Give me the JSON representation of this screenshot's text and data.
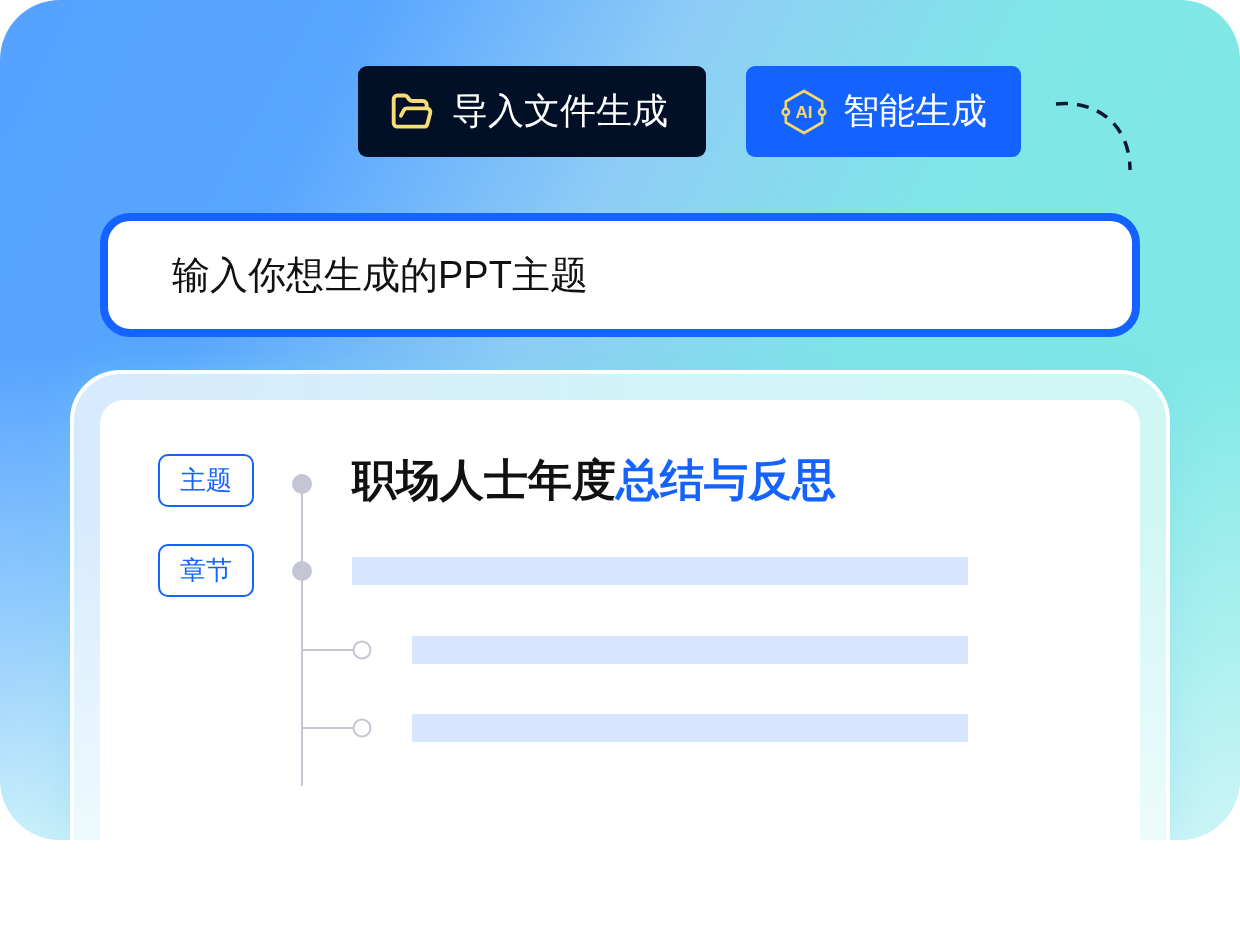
{
  "actions": [
    {
      "kind": "import",
      "label": "导入文件生成"
    },
    {
      "kind": "ai",
      "label": "智能生成",
      "icon_text": "AI"
    }
  ],
  "topic_input": {
    "placeholder": "输入你想生成的PPT主题"
  },
  "outline": {
    "nodes": [
      {
        "kind": "title",
        "tag": "主题",
        "segments": [
          {
            "text": "职场人士年度",
            "highlight": false
          },
          {
            "text": "总结与反思",
            "highlight": true
          }
        ]
      },
      {
        "kind": "skeleton",
        "tag": "章节",
        "children": [
          {
            "kind": "skeleton"
          },
          {
            "kind": "skeleton"
          }
        ]
      }
    ]
  }
}
